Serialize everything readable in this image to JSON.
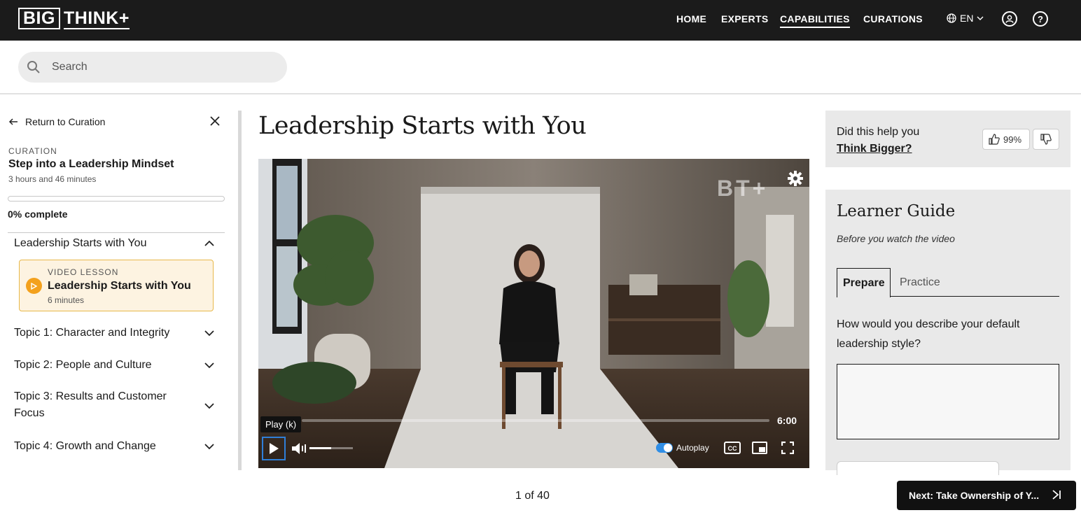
{
  "header": {
    "logo_big": "BIG",
    "logo_think": "THINK+",
    "nav": [
      "HOME",
      "EXPERTS",
      "CAPABILITIES",
      "CURATIONS"
    ],
    "active_nav": "CAPABILITIES",
    "language": "EN"
  },
  "search": {
    "placeholder": "Search"
  },
  "sidebar": {
    "return_label": "Return to Curation",
    "curation_label": "CURATION",
    "curation_title": "Step into a Leadership Mindset",
    "curation_duration": "3 hours and 46 minutes",
    "progress_fraction": 0,
    "progress_label": "0% complete",
    "sections": [
      {
        "title": "Leadership Starts with You",
        "expanded": true
      },
      {
        "title": "Topic 1: Character and Integrity",
        "expanded": false
      },
      {
        "title": "Topic 2: People and Culture",
        "expanded": false
      },
      {
        "title": "Topic 3: Results and Customer Focus",
        "expanded": false
      },
      {
        "title": "Topic 4: Growth and Change",
        "expanded": false
      }
    ],
    "lesson": {
      "label": "VIDEO LESSON",
      "title": "Leadership Starts with You",
      "duration": "6 minutes"
    }
  },
  "main": {
    "title": "Leadership Starts with You",
    "player": {
      "tooltip": "Play (k)",
      "duration": "6:00",
      "autoplay_label": "Autoplay",
      "autoplay_on": true,
      "progress_fraction": 0,
      "volume_fraction": 0.5,
      "watermark": "BT+"
    },
    "pager": "1 of 40",
    "next_label": "Next: Take Ownership of Y..."
  },
  "feedback": {
    "question_line1": "Did this help you",
    "question_link": "Think Bigger?",
    "thumbs_up_pct": "99%"
  },
  "learner_guide": {
    "title": "Learner Guide",
    "subtitle": "Before you watch the video",
    "tabs": [
      "Prepare",
      "Practice"
    ],
    "active_tab": "Prepare",
    "question": "How would you describe your default leadership style?",
    "answer_value": ""
  },
  "colors": {
    "header_bg": "#1b1b1b",
    "lesson_bg": "#fdf3e1",
    "lesson_border": "#e8b84a",
    "play_accent": "#f3a11d",
    "focus_blue": "#2f7fd8",
    "panel_bg": "#e9e9e9"
  }
}
